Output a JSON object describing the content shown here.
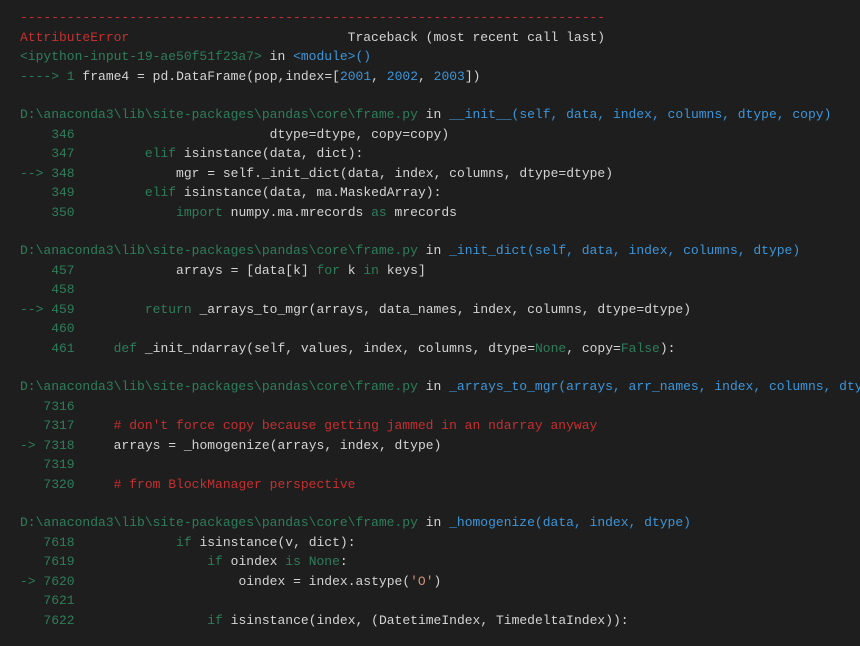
{
  "header": {
    "dashes": "---------------------------------------------------------------------------",
    "error_name": "AttributeError",
    "spacer": "                            ",
    "traceback_label": "Traceback (most recent call last)"
  },
  "cell": {
    "input_ref": "<ipython-input-19-ae50f51f23a7>",
    "in_word": " in ",
    "module": "<module>",
    "parens": "()",
    "arrow": "----> 1 ",
    "code_pre": "frame4 ",
    "eq": "=",
    "code_mid": " pd",
    "dot": ".",
    "df": "DataFrame",
    "open": "(",
    "pop": "pop",
    "comma": ",",
    "idx": "index",
    "eq2": "=",
    "lb": "[",
    "y1": "2001",
    "y2": "2002",
    "y3": "2003",
    "rb": "])"
  },
  "frame1": {
    "path": "D:\\anaconda3\\lib\\site-packages\\pandas\\core\\frame.py",
    "in": " in ",
    "fn": "__init__",
    "sig": "(self, data, index, columns, dtype, copy)",
    "l346_ln": "    346 ",
    "l346_code": "                        dtype",
    "l346_eq": "=",
    "l346_b": "dtype",
    "l346_c": ", copy",
    "l346_d": "copy",
    "l346_e": ")",
    "l347_ln": "    347 ",
    "l347_elif": "        elif",
    "l347_a": " isinstance",
    "l347_b": "(",
    "l347_c": "data",
    "l347_d": ", ",
    "l347_e": "dict",
    "l347_f": "):",
    "l348_ln": "--> 348 ",
    "l348_a": "            mgr ",
    "l348_eq": "=",
    "l348_b": " self",
    "l348_dot": ".",
    "l348_c": "_init_dict",
    "l348_d": "(",
    "l348_e": "data",
    "l348_f": ", ",
    "l348_g": "index",
    "l348_h": "columns",
    "l348_i": "dtype",
    "l348_j": "dtype",
    "l348_k": ")",
    "l349_ln": "    349 ",
    "l349_elif": "        elif",
    "l349_a": " isinstance",
    "l349_b": "(",
    "l349_c": "data",
    "l349_d": ", ",
    "l349_e": "ma",
    "l349_f": ".",
    "l349_g": "MaskedArray",
    "l349_h": "):",
    "l350_ln": "    350 ",
    "l350_imp": "            import",
    "l350_a": " numpy",
    "l350_b": ".",
    "l350_c": "ma",
    "l350_d": "mrecords ",
    "l350_as": "as",
    "l350_e": " mrecords"
  },
  "frame2": {
    "path": "D:\\anaconda3\\lib\\site-packages\\pandas\\core\\frame.py",
    "in": " in ",
    "fn": "_init_dict",
    "sig": "(self, data, index, columns, dtype)",
    "l457_ln": "    457 ",
    "l457_a": "            arrays ",
    "l457_eq": "=",
    "l457_b": " [",
    "l457_c": "data",
    "l457_d": "[",
    "l457_e": "k",
    "l457_f": "]",
    "l457_for": " for ",
    "l457_g": "k ",
    "l457_in": "in ",
    "l457_h": "keys",
    "l457_i": "]",
    "l458_ln": "    458 ",
    "l459_ln": "--> 459 ",
    "l459_ret": "        return ",
    "l459_a": "_arrays_to_mgr",
    "l459_b": "(",
    "l459_c": "arrays",
    "l459_d": ", ",
    "l459_e": "data_names",
    "l459_f": "index",
    "l459_g": "columns",
    "l459_h": "dtype",
    "l459_i": "dtype",
    "l459_j": ")",
    "l460_ln": "    460 ",
    "l461_ln": "    461 ",
    "l461_def": "    def ",
    "l461_a": "_init_ndarray",
    "l461_b": "(",
    "l461_c": "self",
    "l461_d": ", ",
    "l461_e": "values",
    "l461_f": "index",
    "l461_g": "columns",
    "l461_h": "dtype",
    "l461_eq": "=",
    "l461_none": "None",
    "l461_i": ", copy",
    "l461_false": "False",
    "l461_j": "):"
  },
  "frame3": {
    "path": "D:\\anaconda3\\lib\\site-packages\\pandas\\core\\frame.py",
    "in": " in ",
    "fn": "_arrays_to_mgr",
    "sig": "(arrays, arr_names, index, columns, dtype)",
    "l7316_ln": "   7316 ",
    "l7317_ln": "   7317 ",
    "l7317_c": "    # don't force copy because getting jammed in an ndarray anyway",
    "l7318_ln": "-> 7318 ",
    "l7318_a": "    arrays ",
    "l7318_eq": "=",
    "l7318_b": " _homogenize",
    "l7318_c": "(",
    "l7318_d": "arrays",
    "l7318_e": ", ",
    "l7318_f": "index",
    "l7318_g": "dtype",
    "l7318_h": ")",
    "l7319_ln": "   7319 ",
    "l7320_ln": "   7320 ",
    "l7320_c": "    # from BlockManager perspective"
  },
  "frame4": {
    "path": "D:\\anaconda3\\lib\\site-packages\\pandas\\core\\frame.py",
    "in": " in ",
    "fn": "_homogenize",
    "sig": "(data, index, dtype)",
    "l7618_ln": "   7618 ",
    "l7618_if": "            if",
    "l7618_a": " isinstance",
    "l7618_b": "(",
    "l7618_c": "v",
    "l7618_d": ", ",
    "l7618_e": "dict",
    "l7618_f": "):",
    "l7619_ln": "   7619 ",
    "l7619_if": "                if",
    "l7619_a": " oindex ",
    "l7619_is": "is ",
    "l7619_none": "None",
    "l7619_b": ":",
    "l7620_ln": "-> 7620 ",
    "l7620_a": "                    oindex ",
    "l7620_eq": "=",
    "l7620_b": " index",
    "l7620_c": ".",
    "l7620_d": "astype",
    "l7620_e": "(",
    "l7620_f": "'O'",
    "l7620_g": ")",
    "l7621_ln": "   7621 ",
    "l7622_ln": "   7622 ",
    "l7622_if": "                if",
    "l7622_a": " isinstance",
    "l7622_b": "(",
    "l7622_c": "index",
    "l7622_d": ", ",
    "l7622_e": "(",
    "l7622_f": "DatetimeIndex",
    "l7622_g": "TimedeltaIndex",
    "l7622_h": ")):"
  }
}
